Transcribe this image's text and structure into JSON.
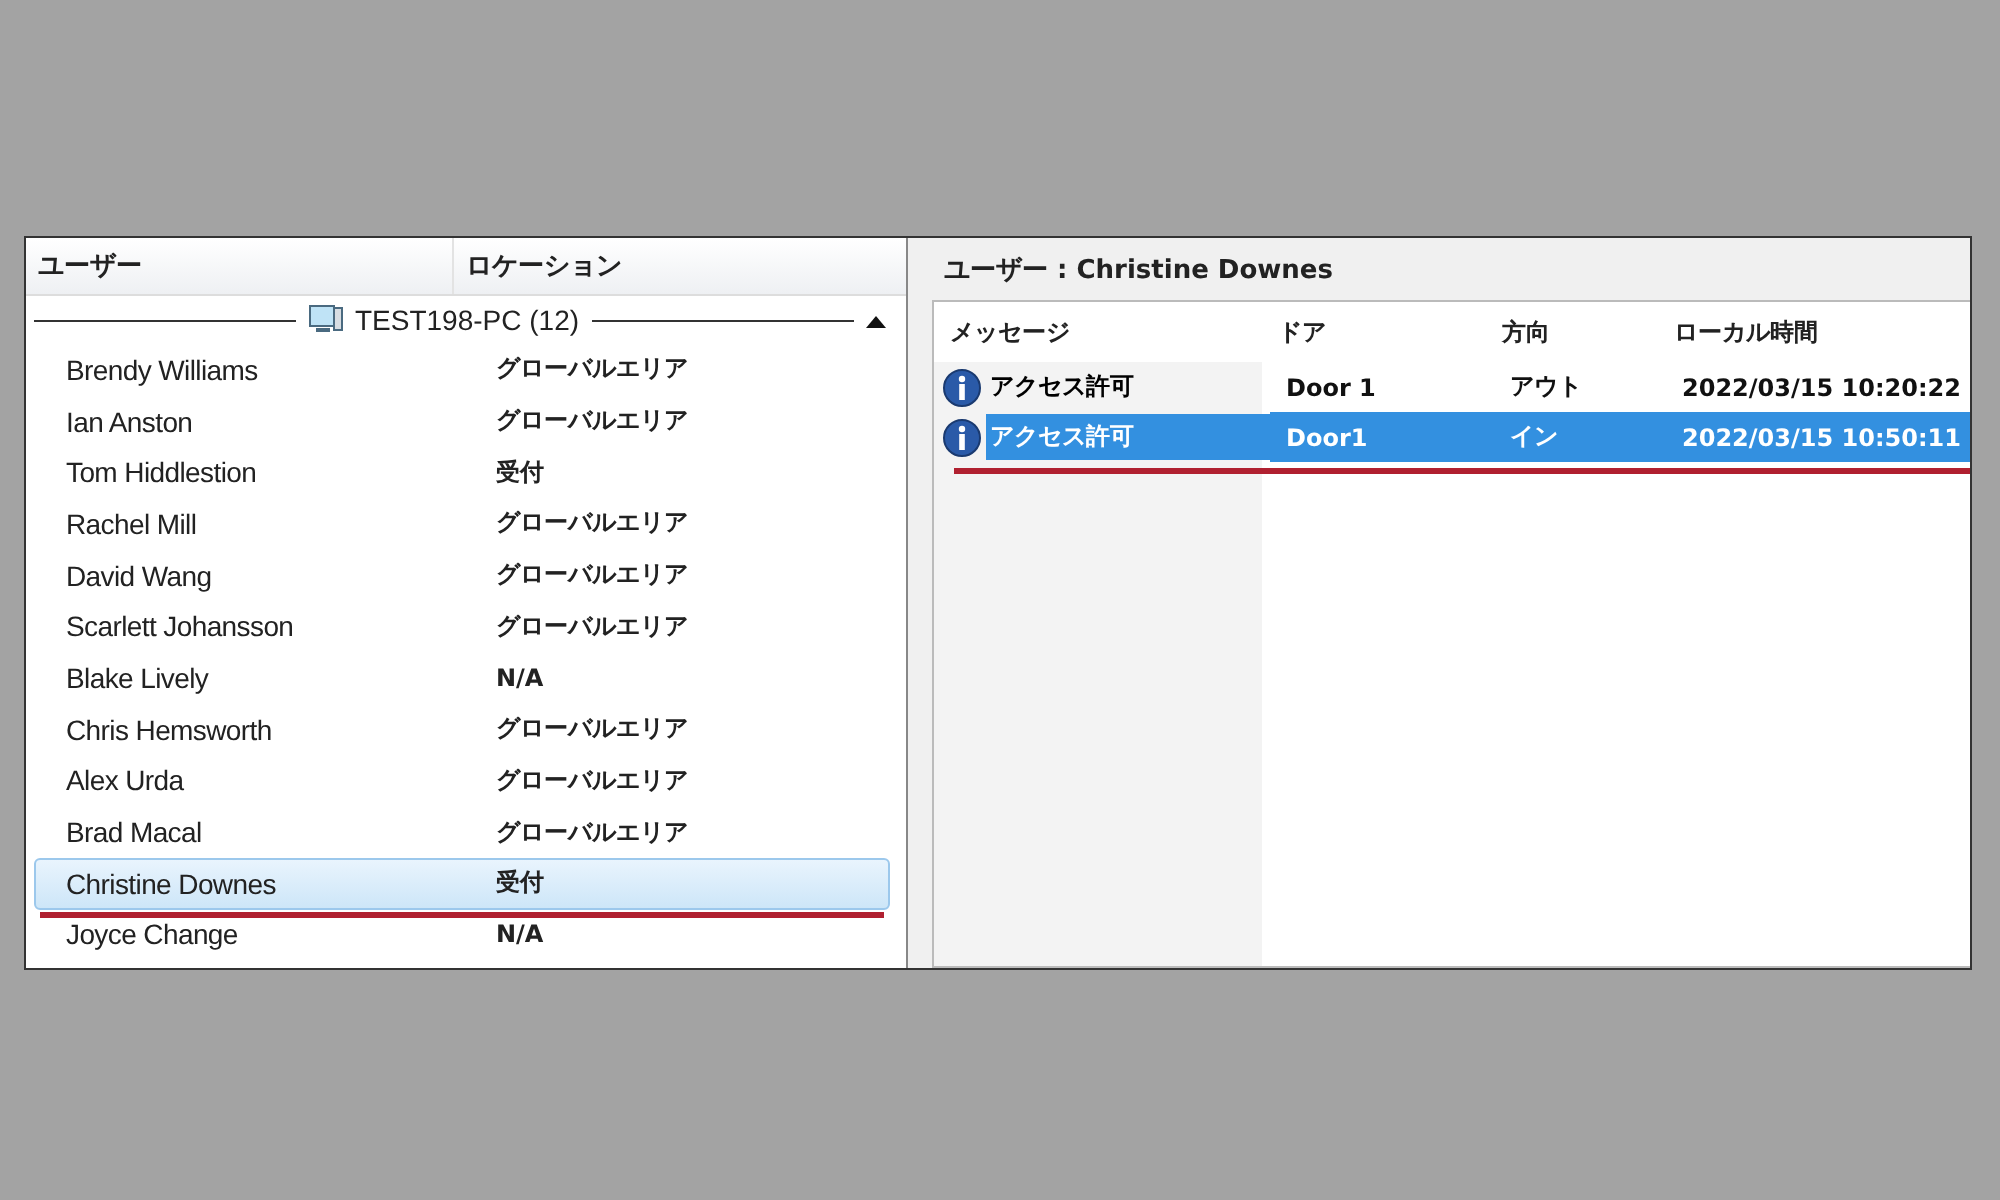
{
  "users_panel": {
    "columns": [
      "ユーザー",
      "ロケーション"
    ],
    "group": {
      "label": "TEST198-PC (12)",
      "expanded": true
    },
    "rows": [
      {
        "name": "Brendy Williams",
        "location": "グローバルエリア",
        "selected": false,
        "underlined": false
      },
      {
        "name": "Ian Anston",
        "location": "グローバルエリア",
        "selected": false,
        "underlined": false
      },
      {
        "name": "Tom Hiddlestion",
        "location": "受付",
        "selected": false,
        "underlined": false
      },
      {
        "name": "Rachel Mill",
        "location": "グローバルエリア",
        "selected": false,
        "underlined": false
      },
      {
        "name": "David Wang",
        "location": "グローバルエリア",
        "selected": false,
        "underlined": false
      },
      {
        "name": "Scarlett  Johansson",
        "location": "グローバルエリア",
        "selected": false,
        "underlined": false
      },
      {
        "name": "Blake Lively",
        "location": "N/A",
        "selected": false,
        "underlined": false
      },
      {
        "name": "Chris Hemsworth",
        "location": "グローバルエリア",
        "selected": false,
        "underlined": false
      },
      {
        "name": "Alex Urda",
        "location": "グローバルエリア",
        "selected": false,
        "underlined": false
      },
      {
        "name": "Brad Macal",
        "location": "グローバルエリア",
        "selected": false,
        "underlined": false
      },
      {
        "name": "Christine Downes",
        "location": "受付",
        "selected": true,
        "underlined": true
      },
      {
        "name": "Joyce Change",
        "location": "N/A",
        "selected": false,
        "underlined": false
      }
    ]
  },
  "events_panel": {
    "title": "ユーザー : Christine Downes",
    "columns": [
      "メッセージ",
      "ドア",
      "方向",
      "ローカル時間"
    ],
    "rows": [
      {
        "message": "アクセス許可",
        "door": "Door 1",
        "direction": "アウト",
        "time": "2022/03/15 10:20:22",
        "selected": false,
        "underlined": false
      },
      {
        "message": "アクセス許可",
        "door": "Door1",
        "direction": "イン",
        "time": "2022/03/15 10:50:11",
        "selected": true,
        "underlined": true
      }
    ]
  }
}
